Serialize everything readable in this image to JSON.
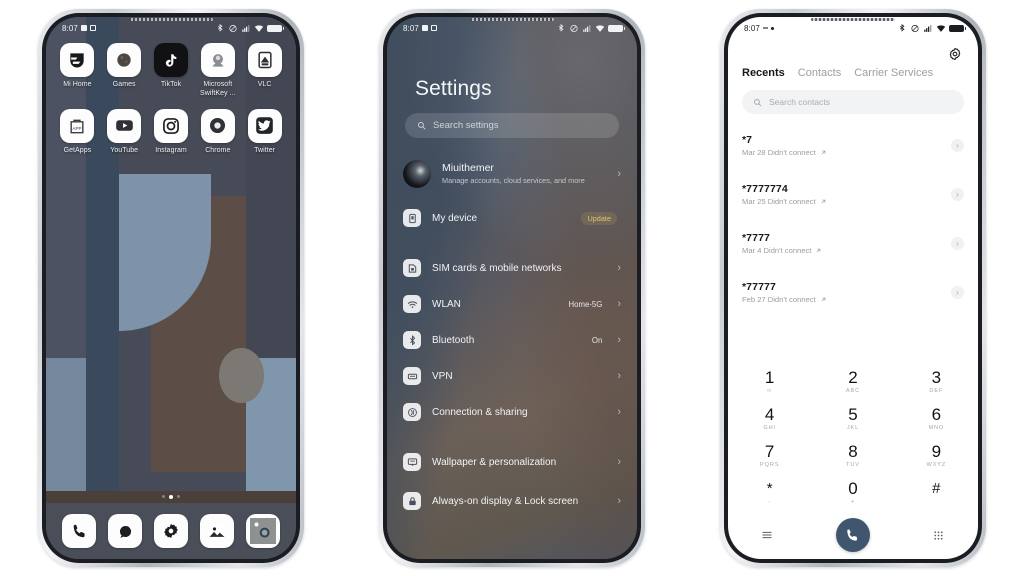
{
  "colors": {
    "accent_call": "#3f566e",
    "update_badge": "#e2c76a",
    "wallpaper_blue": "#3a4a5c",
    "wallpaper_brown": "#5c4e46",
    "wallpaper_lightblue": "#7e93aa",
    "wallpaper_base": "#474b57"
  },
  "status_bar": {
    "time": "8:07",
    "icons": [
      "bluetooth-icon",
      "dnd-icon",
      "signal-icon",
      "wifi-icon",
      "battery-icon"
    ]
  },
  "home": {
    "rows": [
      [
        {
          "label": "Mi Home",
          "icon": "mi-home-icon"
        },
        {
          "label": "Games",
          "icon": "games-icon"
        },
        {
          "label": "TikTok",
          "icon": "tiktok-icon"
        },
        {
          "label": "Microsoft SwiftKey ...",
          "icon": "swiftkey-icon"
        },
        {
          "label": "VLC",
          "icon": "vlc-icon"
        }
      ],
      [
        {
          "label": "GetApps",
          "icon": "getapps-icon"
        },
        {
          "label": "YouTube",
          "icon": "youtube-icon"
        },
        {
          "label": "Instagram",
          "icon": "instagram-icon"
        },
        {
          "label": "Chrome",
          "icon": "chrome-icon"
        },
        {
          "label": "Twitter",
          "icon": "twitter-icon"
        }
      ]
    ],
    "page_dots": {
      "count": 3,
      "active_index": 1
    },
    "dock": [
      {
        "icon": "phone-icon",
        "label": "Phone"
      },
      {
        "icon": "messages-icon",
        "label": "Messages"
      },
      {
        "icon": "settings-gear-icon",
        "label": "Settings"
      },
      {
        "icon": "gallery-icon",
        "label": "Gallery"
      },
      {
        "icon": "camera-icon",
        "label": "Camera"
      }
    ]
  },
  "settings": {
    "title": "Settings",
    "search_placeholder": "Search settings",
    "account": {
      "name": "Miuithemer",
      "subtitle": "Manage accounts, cloud services, and more"
    },
    "groups": [
      {
        "items": [
          {
            "label": "My device",
            "icon": "device-icon",
            "badge": "Update",
            "value": ""
          }
        ]
      },
      {
        "items": [
          {
            "label": "SIM cards & mobile networks",
            "icon": "sim-card-icon",
            "value": ""
          },
          {
            "label": "WLAN",
            "icon": "wifi-icon",
            "value": "Home-5G"
          },
          {
            "label": "Bluetooth",
            "icon": "bluetooth-icon",
            "value": "On"
          },
          {
            "label": "VPN",
            "icon": "vpn-icon",
            "value": ""
          },
          {
            "label": "Connection & sharing",
            "icon": "connection-sharing-icon",
            "value": ""
          }
        ]
      },
      {
        "items": [
          {
            "label": "Wallpaper & personalization",
            "icon": "wallpaper-icon",
            "value": ""
          },
          {
            "label": "Always-on display & Lock screen",
            "icon": "lock-icon",
            "value": ""
          }
        ]
      }
    ]
  },
  "dialer": {
    "tabs": [
      {
        "label": "Recents",
        "active": true
      },
      {
        "label": "Contacts",
        "active": false
      },
      {
        "label": "Carrier Services",
        "active": false
      }
    ],
    "search_placeholder": "Search contacts",
    "settings_icon": "gear-icon",
    "calls": [
      {
        "number": "*7",
        "meta": "Mar 28 Didn't connect"
      },
      {
        "number": "*7777774",
        "meta": "Mar 25 Didn't connect"
      },
      {
        "number": "*7777",
        "meta": "Mar 4 Didn't connect"
      },
      {
        "number": "*77777",
        "meta": "Feb 27 Didn't connect"
      }
    ],
    "keypad": [
      {
        "digit": "1",
        "sub": "∞"
      },
      {
        "digit": "2",
        "sub": "ABC"
      },
      {
        "digit": "3",
        "sub": "DEF"
      },
      {
        "digit": "4",
        "sub": "GHI"
      },
      {
        "digit": "5",
        "sub": "JKL"
      },
      {
        "digit": "6",
        "sub": "MNO"
      },
      {
        "digit": "7",
        "sub": "PQRS"
      },
      {
        "digit": "8",
        "sub": "TUV"
      },
      {
        "digit": "9",
        "sub": "WXYZ"
      },
      {
        "digit": "*",
        "sub": ","
      },
      {
        "digit": "0",
        "sub": "+"
      },
      {
        "digit": "#",
        "sub": ""
      }
    ],
    "bottom_bar": [
      {
        "icon": "menu-icon"
      },
      {
        "icon": "call-icon"
      },
      {
        "icon": "keypad-icon"
      }
    ]
  }
}
